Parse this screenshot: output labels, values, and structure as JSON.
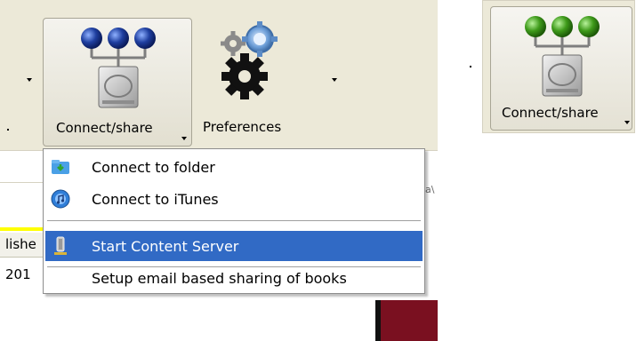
{
  "toolbar": {
    "connect_share_label": "Connect/share",
    "preferences_label": "Preferences"
  },
  "menu": {
    "items": [
      {
        "label": "Connect to folder",
        "icon": "folder-icon"
      },
      {
        "label": "Connect to iTunes",
        "icon": "itunes-icon"
      },
      {
        "label": "Start Content Server",
        "icon": "server-icon",
        "selected": true
      },
      {
        "label": "Setup email based sharing of books",
        "icon": ""
      }
    ]
  },
  "background": {
    "column_header_fragment": "lishe",
    "cell_fragment": "201",
    "side_fragment": "a\\"
  },
  "right_button": {
    "label": "Connect/share"
  },
  "colors": {
    "toolbar_bg": "#ece9d8",
    "menu_highlight": "#316ac5",
    "blue_device_nodes": "#1f3fa0",
    "green_device_nodes": "#3e9a1a"
  }
}
